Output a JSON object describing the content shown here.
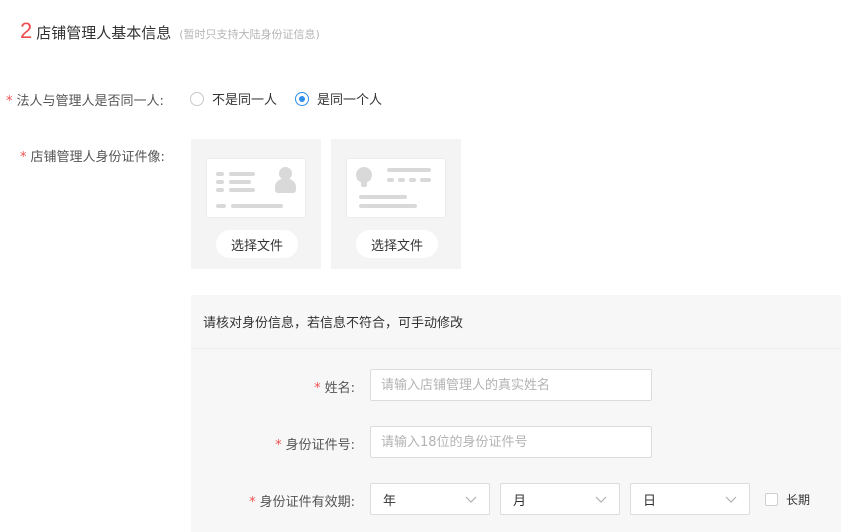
{
  "section": {
    "number": "2",
    "title": "店铺管理人基本信息",
    "note": "(暂时只支持大陆身份证信息)"
  },
  "same_person": {
    "label": "法人与管理人是否同一人:",
    "options": [
      "不是同一人",
      "是同一个人"
    ],
    "selected": "是同一个人"
  },
  "id_images": {
    "label": "店铺管理人身份证件像:",
    "front_button": "选择文件",
    "back_button": "选择文件"
  },
  "verify": {
    "heading": "请核对身份信息，若信息不符合，可手动修改",
    "name": {
      "label": "姓名:",
      "placeholder": "请输入店铺管理人的真实姓名"
    },
    "id_number": {
      "label": "身份证件号:",
      "placeholder": "请输入18位的身份证件号"
    },
    "validity": {
      "label": "身份证件有效期:",
      "year": "年",
      "month": "月",
      "day": "日",
      "long_term": "长期",
      "long_term_checked": false
    }
  },
  "required_mark": "*",
  "colors": {
    "accent": "#2f8eea",
    "required": "#f04e4e",
    "panel_bg": "#f7f7f7"
  }
}
